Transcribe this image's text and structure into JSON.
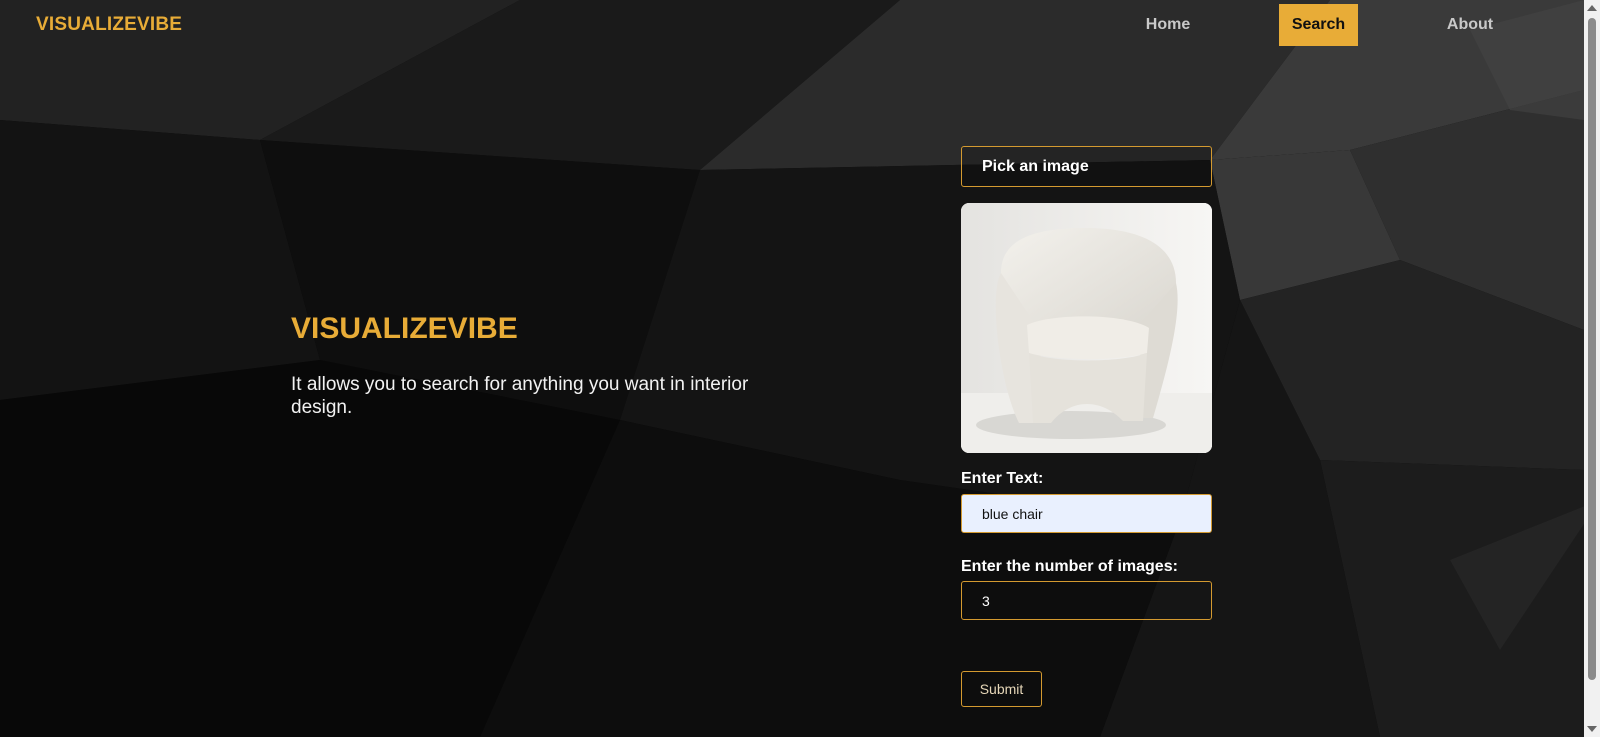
{
  "nav": {
    "brand": "VISUALIZEVIBE",
    "links": [
      {
        "label": "Home",
        "active": false
      },
      {
        "label": "Search",
        "active": true
      },
      {
        "label": "About",
        "active": false
      }
    ]
  },
  "hero": {
    "title": "VISUALIZEVIBE",
    "description": "It allows you to search for anything you want in interior design."
  },
  "form": {
    "pick_image_label": "Pick an image",
    "preview_icon": "armchair-photo",
    "text_label": "Enter Text:",
    "text_value": "blue chair",
    "count_label": "Enter the number of images:",
    "count_value": "3",
    "submit_label": "Submit"
  },
  "colors": {
    "accent": "#e8ac37",
    "background": "#0b0b0b",
    "input_fill": "#e9f0fe",
    "border": "#d49a30"
  }
}
